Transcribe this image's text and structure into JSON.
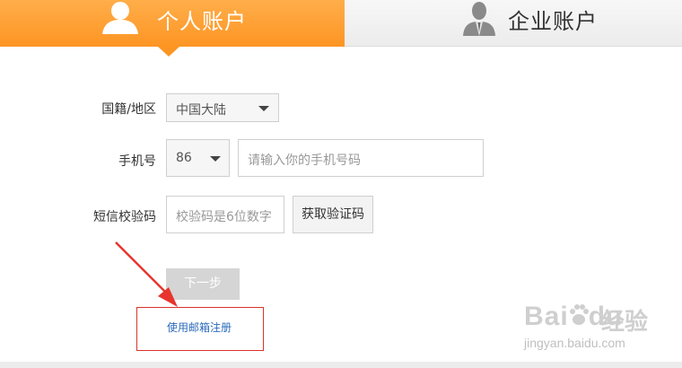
{
  "tabs": {
    "personal": {
      "label": "个人账户",
      "active": true,
      "icon": "person-icon"
    },
    "company": {
      "label": "企业账户",
      "active": false,
      "icon": "businessman-icon"
    }
  },
  "form": {
    "nationality": {
      "label": "国籍/地区",
      "value": "中国大陆"
    },
    "phone": {
      "label": "手机号",
      "code": "86",
      "placeholder": "请输入你的手机号码"
    },
    "sms": {
      "label": "短信校验码",
      "placeholder": "校验码是6位数字",
      "button": "获取验证码"
    },
    "next_button": "下一步",
    "email_link": "使用邮箱注册"
  },
  "watermark": {
    "brand": "Bai",
    "paw": "paw-icon",
    "brand2": "du",
    "cn": "经验",
    "url": "jingyan.baidu.com"
  },
  "annotation": {
    "arrow_color": "#e8342e",
    "box_color": "#d9332b"
  },
  "colors": {
    "accent": "#fd9523",
    "link": "#2b6cbc"
  }
}
